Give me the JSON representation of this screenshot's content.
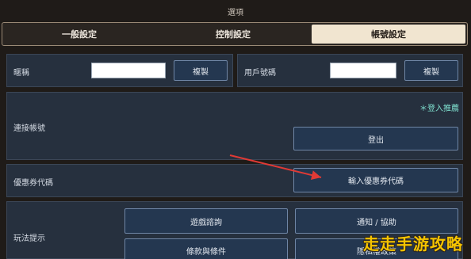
{
  "window": {
    "title": "選項"
  },
  "tabs": [
    {
      "label": "一般設定",
      "active": false
    },
    {
      "label": "控制設定",
      "active": false
    },
    {
      "label": "帳號設定",
      "active": true
    }
  ],
  "account": {
    "id_label": "暱稱",
    "id_copy": "複製",
    "uid_label": "用戶號碼",
    "uid_copy": "複製"
  },
  "link_section": {
    "label": "連接帳號",
    "login_link": "＊登入推薦",
    "logout": "登出"
  },
  "coupon": {
    "label": "優惠券代碼",
    "button": "輸入優惠券代碼"
  },
  "guide": {
    "label": "玩法提示",
    "buttons": [
      "遊戲諮詢",
      "通知 / 協助",
      "條款與條件",
      "隱私權政策"
    ]
  },
  "watermark": "走走手游攻略",
  "colors": {
    "accent_link": "#7fe0cf",
    "arrow": "#e03a35",
    "watermark": "#f5c400"
  }
}
